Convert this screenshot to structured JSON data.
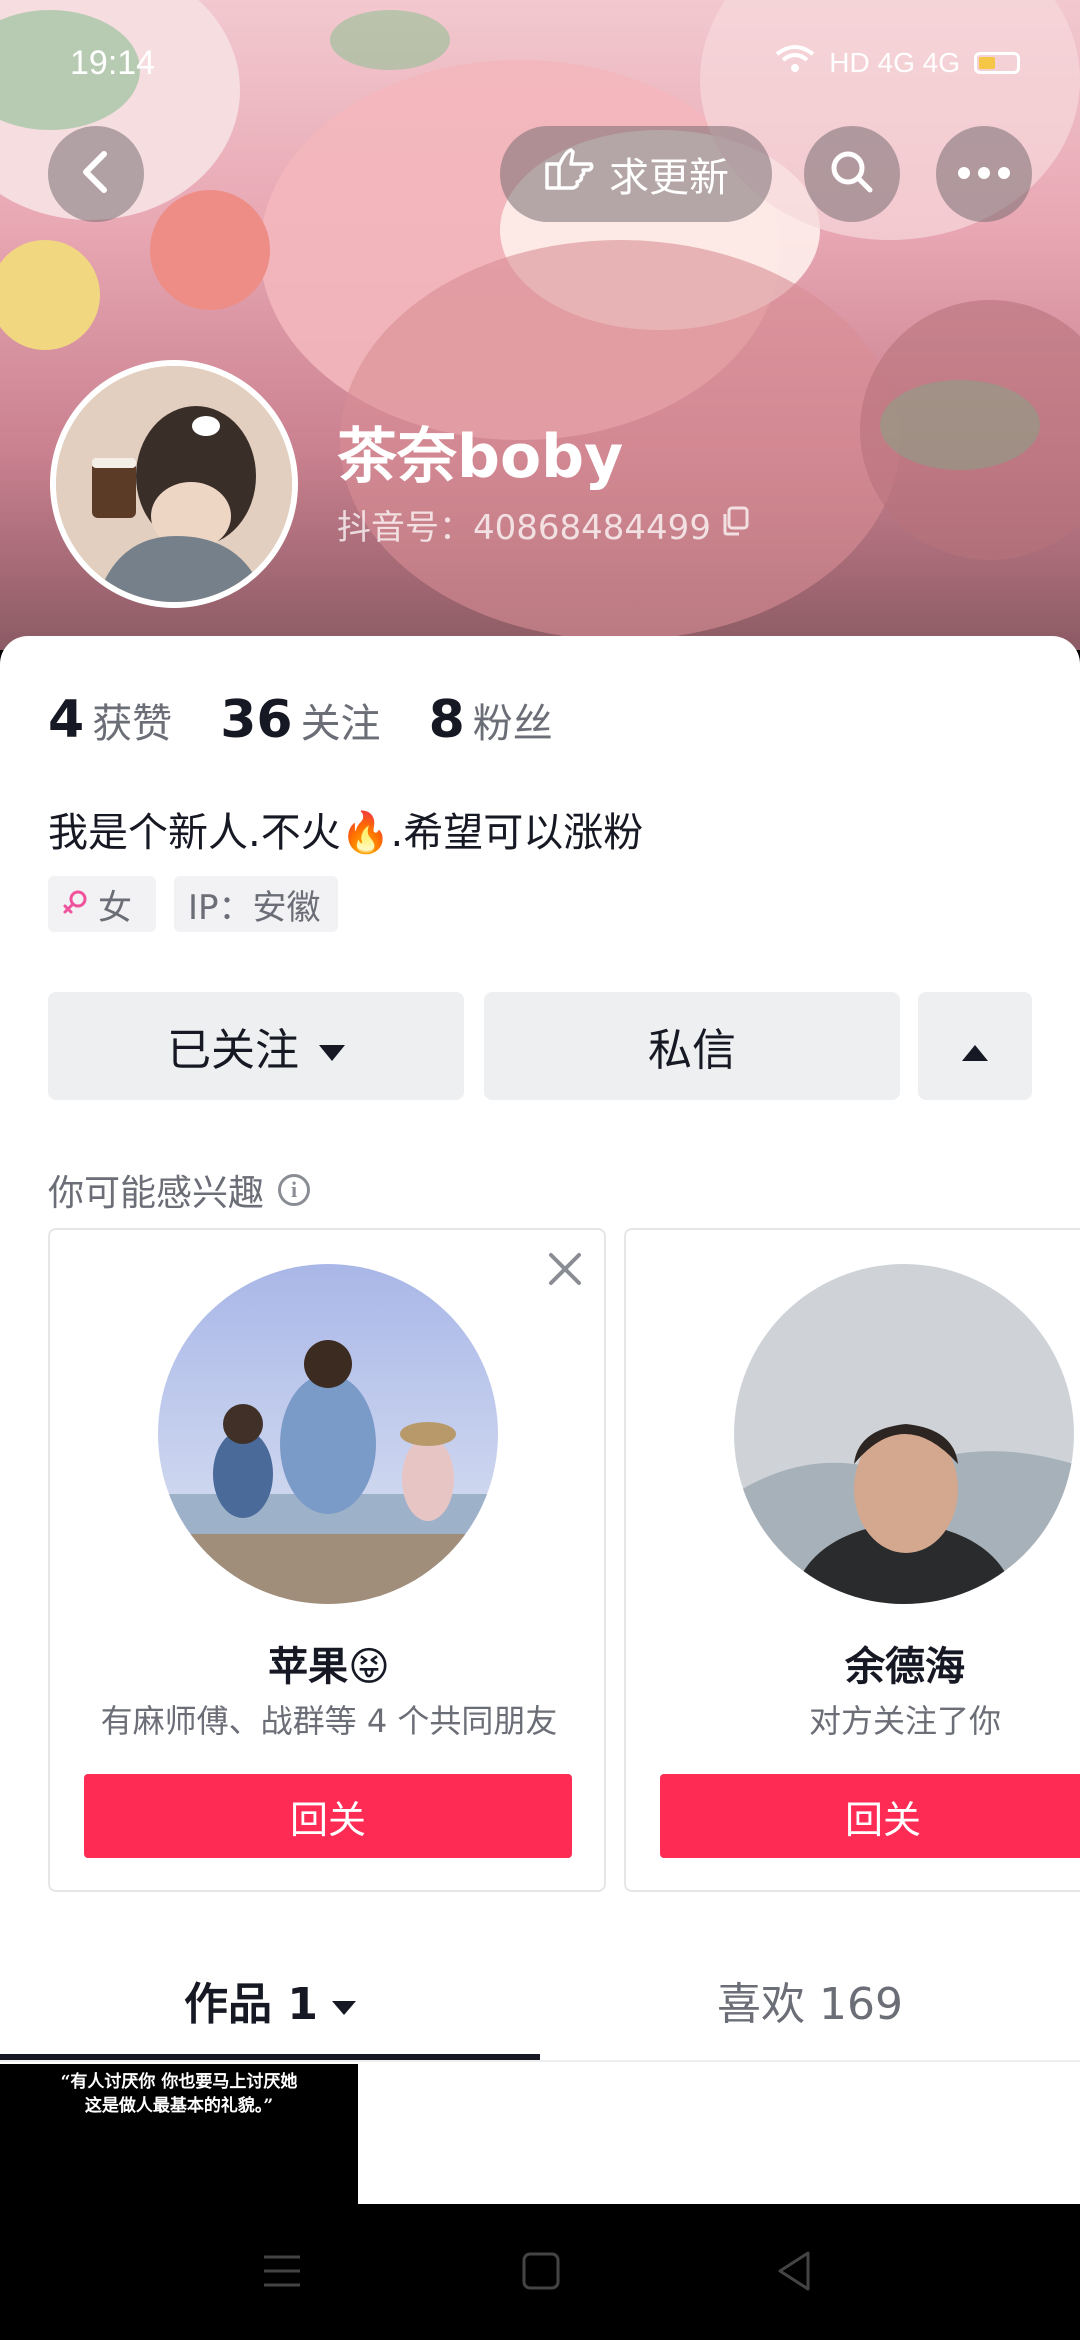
{
  "status_bar": {
    "time": "19:14",
    "network": "HD 4G 4G",
    "battery_level": 0.45
  },
  "header": {
    "request_update_label": "求更新",
    "back_icon": "chevron-left-icon",
    "search_icon": "search-icon",
    "more_icon": "more-dots-icon"
  },
  "profile": {
    "name": "茶奈boby",
    "douyin_id": "抖音号：40868484499",
    "stats": [
      {
        "value": "4",
        "label": "获赞"
      },
      {
        "value": "36",
        "label": "关注"
      },
      {
        "value": "8",
        "label": "粉丝"
      }
    ],
    "bio": "我是个新人.不火🔥.希望可以涨粉",
    "tags": {
      "gender": "女",
      "ip": "IP：安徽"
    }
  },
  "actions": {
    "following_label": "已关注",
    "message_label": "私信"
  },
  "recommend": {
    "title": "你可能感兴趣",
    "cards": [
      {
        "name": "苹果😝",
        "subtitle": "有麻师傅、战群等 4 个共同朋友",
        "button": "回关"
      },
      {
        "name": "余德海",
        "subtitle": "对方关注了你",
        "button": "回关"
      }
    ]
  },
  "tabs": {
    "works": "作品 1",
    "likes": "喜欢 169"
  },
  "video_thumb": {
    "line1": "“有人讨厌你  你也要马上讨厌她",
    "line2": "这是做人最基本的礼貌。”"
  },
  "colors": {
    "accent": "#fe2c55",
    "text_primary": "#161823",
    "text_secondary": "#6b6e76",
    "button_bg": "#eeeff1"
  }
}
